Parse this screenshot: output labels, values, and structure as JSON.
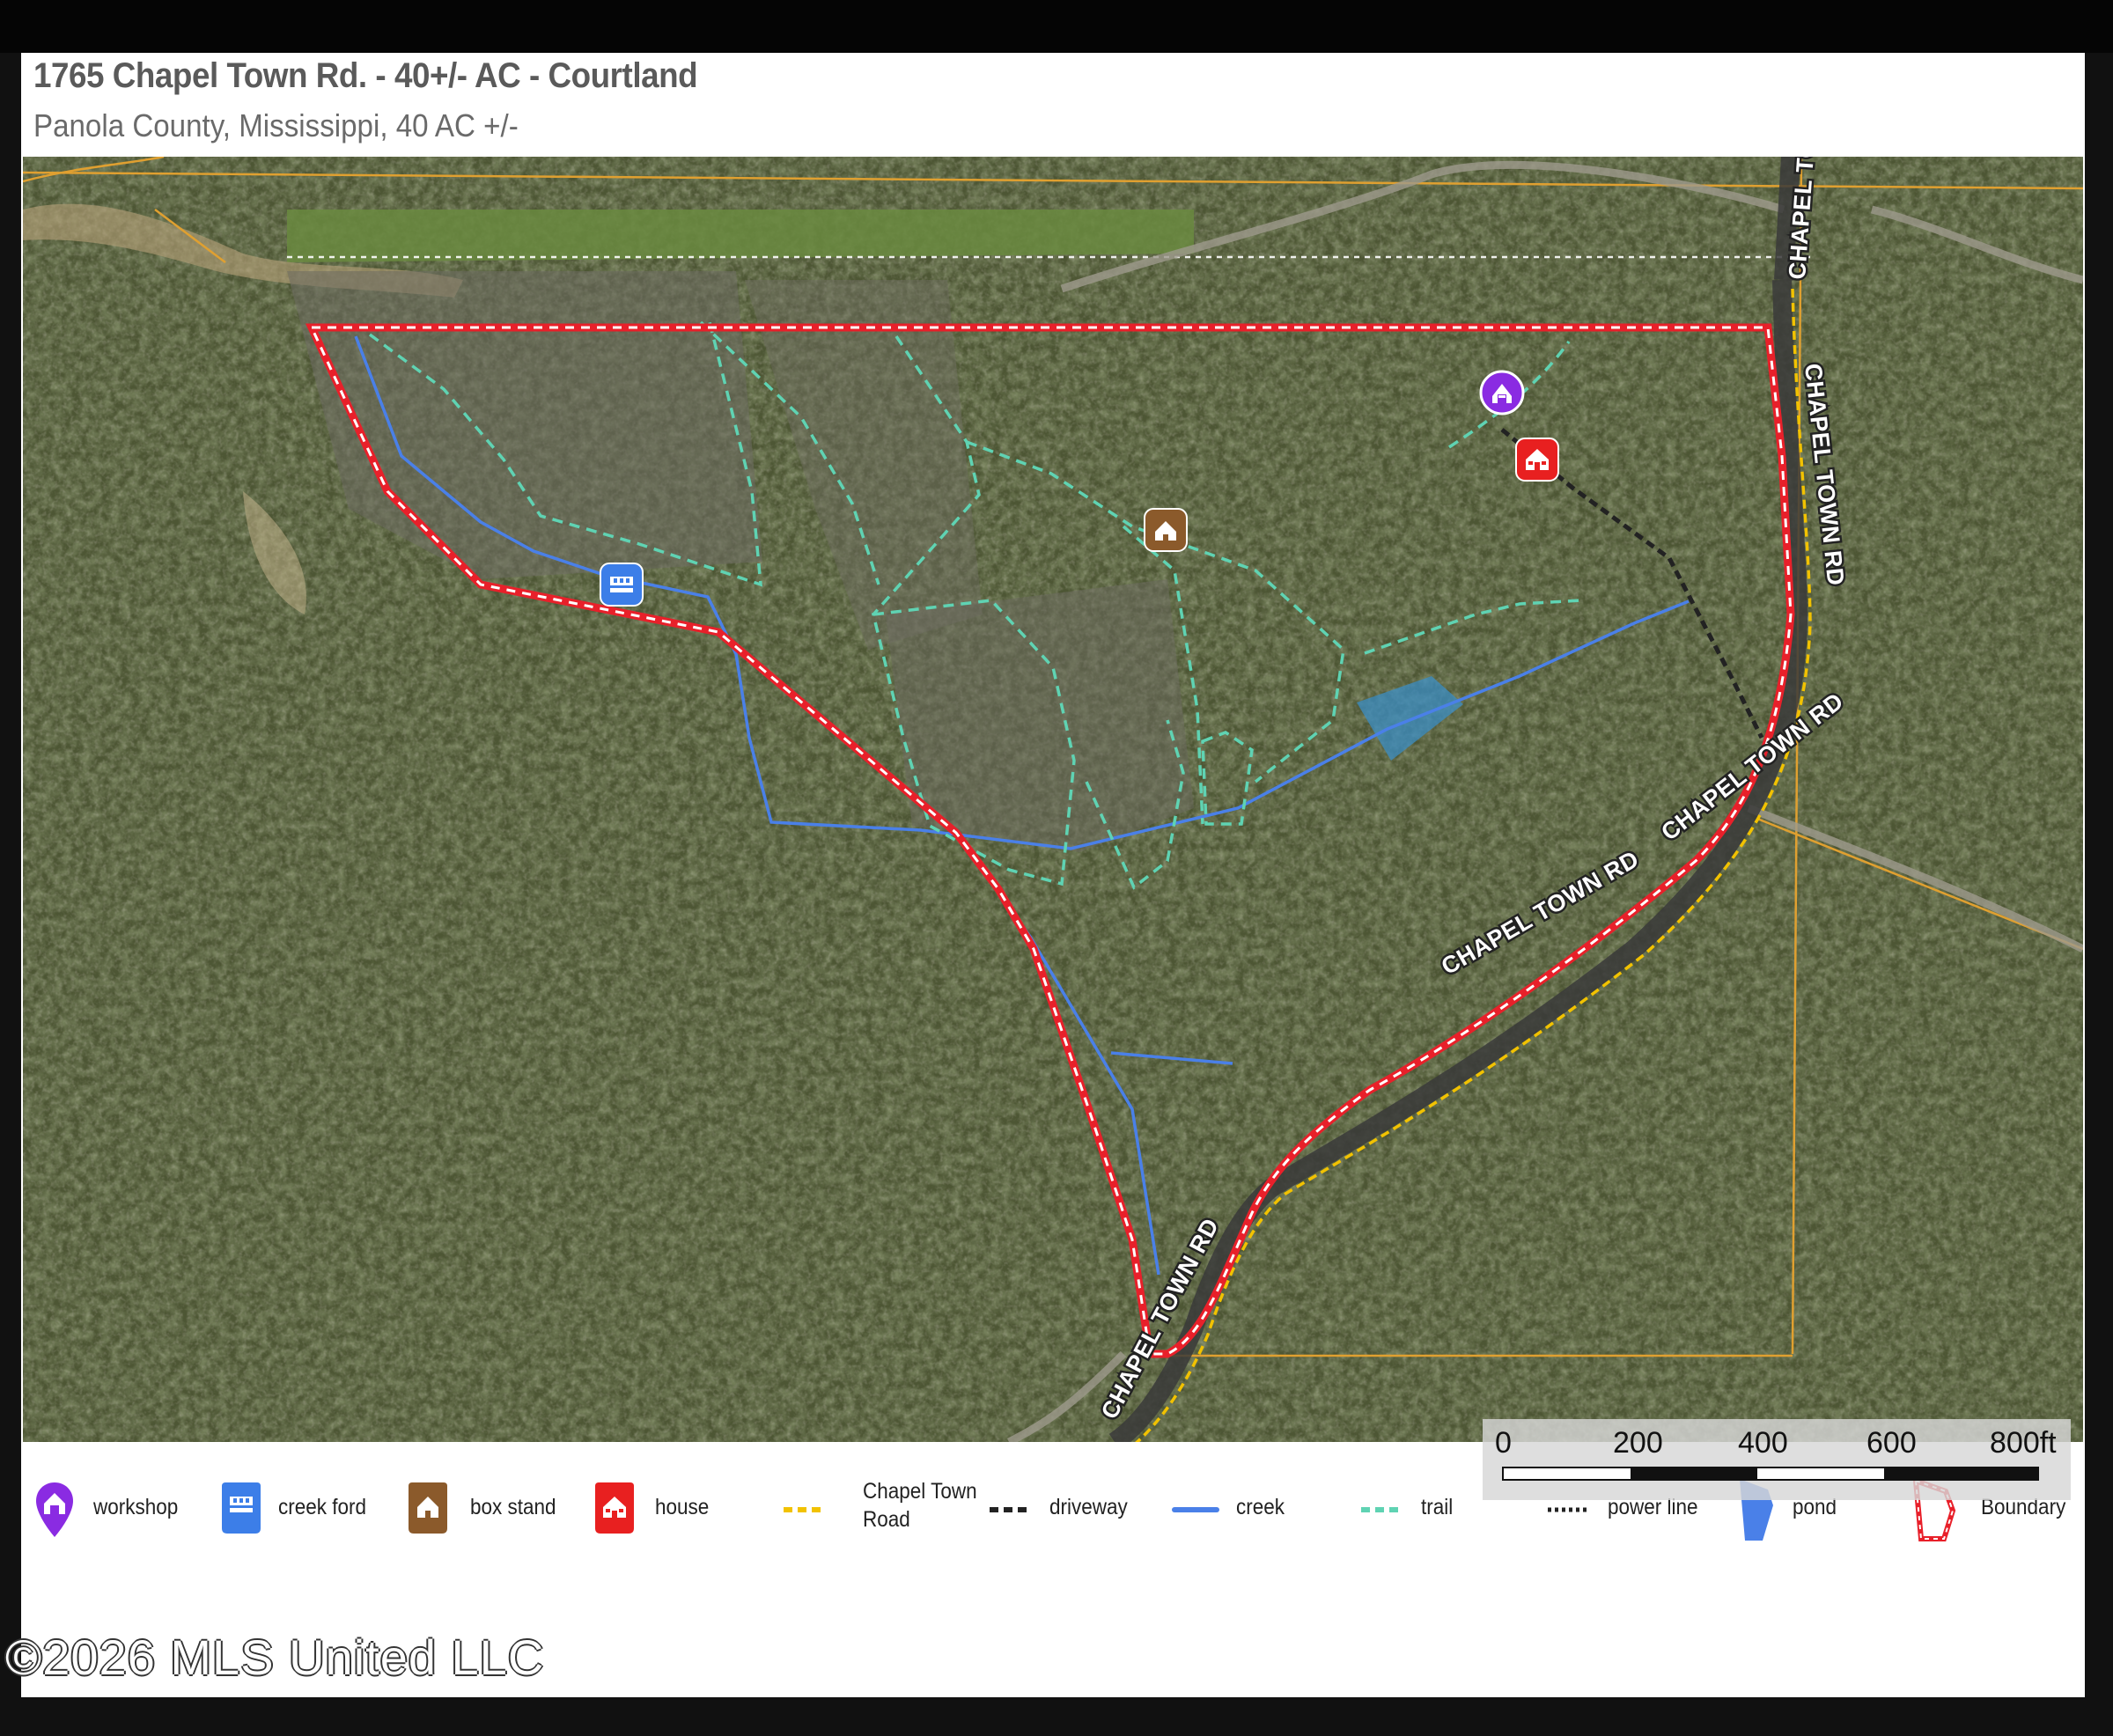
{
  "header": {
    "title": "1765 Chapel Town Rd. - 40+/- AC - Courtland",
    "subtitle": "Panola County, Mississippi, 40 AC +/-"
  },
  "map": {
    "road_labels": [
      "CHAPEL TOWN RD",
      "CHAPEL TOWN RD",
      "CHAPEL TOWN RD",
      "CHAPEL TOWN RD",
      "CHAPEL TO"
    ],
    "scale": {
      "ticks": [
        "0",
        "200",
        "400",
        "600",
        "800ft"
      ]
    },
    "colors": {
      "boundary": "#e8202a",
      "trail": "#5fd3b3",
      "creek": "#4a80e8",
      "road": "#f2c200",
      "driveway": "#222222",
      "pond": "#3b8ec4",
      "parcel_lines": "#e0a030",
      "workshop": "#8a2be2",
      "creek_ford": "#3c7ee8",
      "box_stand": "#8b5a2b",
      "house": "#e82020"
    }
  },
  "legend": {
    "items": [
      {
        "id": "workshop",
        "label": "workshop",
        "icon": "workshop-icon"
      },
      {
        "id": "creek-ford",
        "label": "creek ford",
        "icon": "creek-ford-icon"
      },
      {
        "id": "box-stand",
        "label": "box stand",
        "icon": "box-stand-icon"
      },
      {
        "id": "house",
        "label": "house",
        "icon": "house-icon"
      },
      {
        "id": "chapel-town-road",
        "label_line1": "Chapel Town",
        "label_line2": "Road",
        "icon": "road-dash-icon"
      },
      {
        "id": "driveway",
        "label": "driveway",
        "icon": "driveway-dash-icon"
      },
      {
        "id": "creek",
        "label": "creek",
        "icon": "creek-line-icon"
      },
      {
        "id": "trail",
        "label": "trail",
        "icon": "trail-dash-icon"
      },
      {
        "id": "power-line",
        "label": "power line",
        "icon": "power-line-dots-icon"
      },
      {
        "id": "pond",
        "label": "pond",
        "icon": "pond-shape-icon"
      },
      {
        "id": "boundary",
        "label": "Boundary",
        "icon": "boundary-shape-icon"
      }
    ]
  },
  "footer": {
    "copyright": "©2026 MLS United LLC"
  }
}
